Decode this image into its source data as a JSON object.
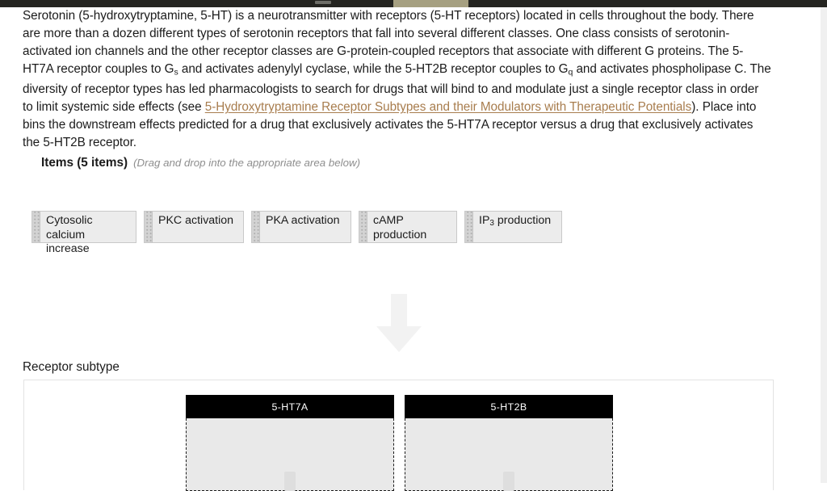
{
  "chrome": {
    "background_color": "#252521",
    "active_tab_color": "#a6a081"
  },
  "passage": {
    "part1": "Serotonin (5-hydroxytryptamine, 5-HT) is a neurotransmitter with receptors (5-HT receptors) located in cells throughout the body. There are more than a dozen different types of serotonin receptors that fall into several different classes. One class consists of serotonin-activated ion channels and the other receptor classes are G-protein-coupled receptors that associate with different G proteins. The 5-HT7A receptor couples to G",
    "sub1": "s",
    "part2": " and activates adenylyl cyclase, while the 5-HT2B receptor couples to G",
    "sub2": "q",
    "part3": " and activates phospholipase C. The diversity of receptor types has led pharmacologists to search for drugs that will bind to and modulate just a single receptor class in order to limit systemic side effects (see ",
    "link_text": "5-Hydroxytryptamine Receptor Subtypes and their Modulators with Therapeutic Potentials",
    "link_color": "#a87d4e",
    "part4": "). Place into bins the downstream effects predicted for a drug that exclusively activates the 5-HT7A receptor versus a drug that exclusively activates the 5-HT2B receptor."
  },
  "items_section": {
    "title": "Items (5 items)",
    "hint": "(Drag and drop into the appropriate area below)",
    "count": 5,
    "items": [
      {
        "id": "item-1",
        "label_before": "Cytosolic calcium\nincrease",
        "sub": "",
        "label_after": ""
      },
      {
        "id": "item-2",
        "label_before": "PKC activation",
        "sub": "",
        "label_after": ""
      },
      {
        "id": "item-3",
        "label_before": "PKA activation",
        "sub": "",
        "label_after": ""
      },
      {
        "id": "item-4",
        "label_before": "cAMP\nproduction",
        "sub": "",
        "label_after": ""
      },
      {
        "id": "item-5",
        "label_before": "IP",
        "sub": "3",
        "label_after": " production"
      }
    ]
  },
  "drop_arrow": {
    "icon": "arrow-down-icon",
    "color": "#f2f2f2"
  },
  "bins_section": {
    "label": "Receptor subtype",
    "bins": [
      {
        "id": "bin-5ht7a",
        "title": "5-HT7A",
        "items": []
      },
      {
        "id": "bin-5ht2b",
        "title": "5-HT2B",
        "items": []
      }
    ],
    "header_bg": "#000000",
    "header_fg": "#ffffff",
    "drop_bg": "#e9e9e9"
  }
}
